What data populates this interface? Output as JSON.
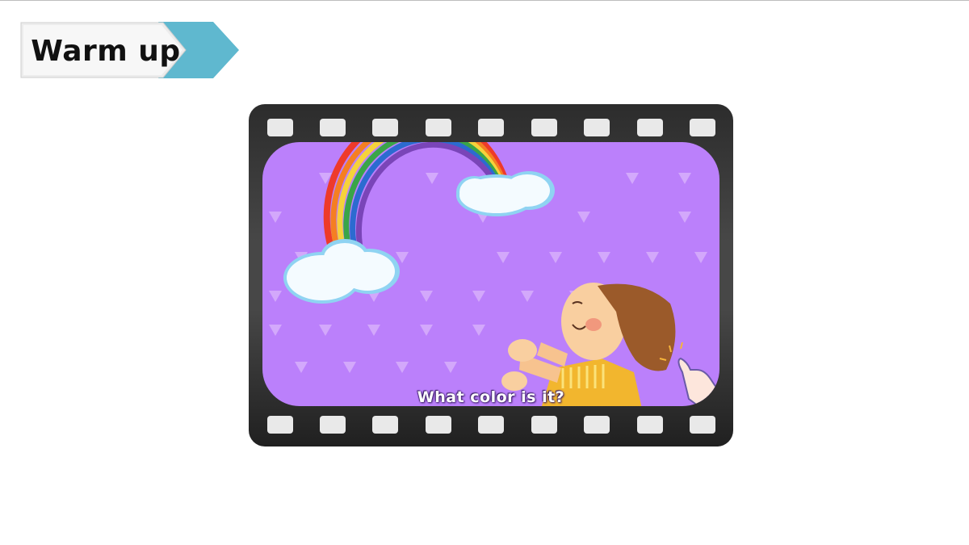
{
  "header": {
    "title": "Warm up",
    "accent_color": "#5fb8cf"
  },
  "video": {
    "subtitle": "What color is it?",
    "background_color": "#bb80fb",
    "frame_color": "#3c3c3c",
    "icons": [
      "rainbow-icon",
      "cloud-icon",
      "child-illustration",
      "pointer-hand-icon"
    ]
  }
}
